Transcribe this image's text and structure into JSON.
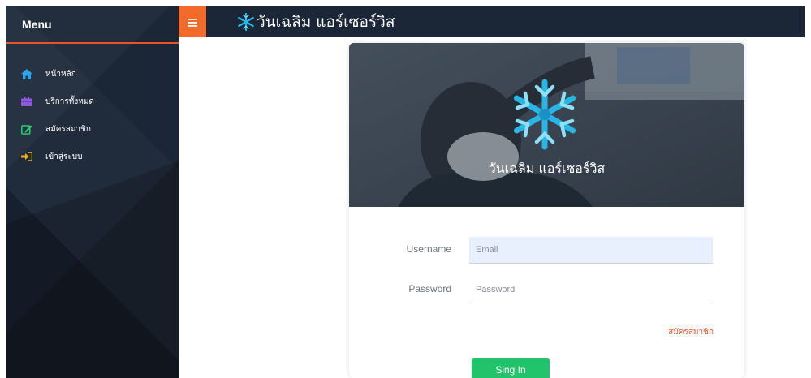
{
  "sidebar": {
    "title": "Menu",
    "items": [
      {
        "label": "หน้าหลัก",
        "icon": "home-icon",
        "icon_color": "#2aa6f0"
      },
      {
        "label": "บริการทั้งหมด",
        "icon": "briefcase-icon",
        "icon_color": "#8e5cd9"
      },
      {
        "label": "สมัครสมาชิก",
        "icon": "edit-icon",
        "icon_color": "#2ecc71"
      },
      {
        "label": "เข้าสู่ระบบ",
        "icon": "sign-in-icon",
        "icon_color": "#f5b400"
      }
    ]
  },
  "topbar": {
    "brand_name": "วันเฉลิม แอร์เซอร์วิส",
    "menu_button_color": "#f26b2a",
    "brand_logo_icon": "snowflake-icon"
  },
  "hero": {
    "title": "วันเฉลิม แอร์เซอร์วิส",
    "logo_icon": "snowflake-icon",
    "logo_color": "#27b6e6"
  },
  "form": {
    "username_label": "Username",
    "username_placeholder": "Email",
    "password_label": "Password",
    "password_placeholder": "Password",
    "register_link": "สมัครสมาชิก",
    "signin_button": "Sing In"
  },
  "colors": {
    "nav_background": "#1b2637",
    "accent_orange": "#e8532a",
    "signin_green": "#21c46b"
  }
}
